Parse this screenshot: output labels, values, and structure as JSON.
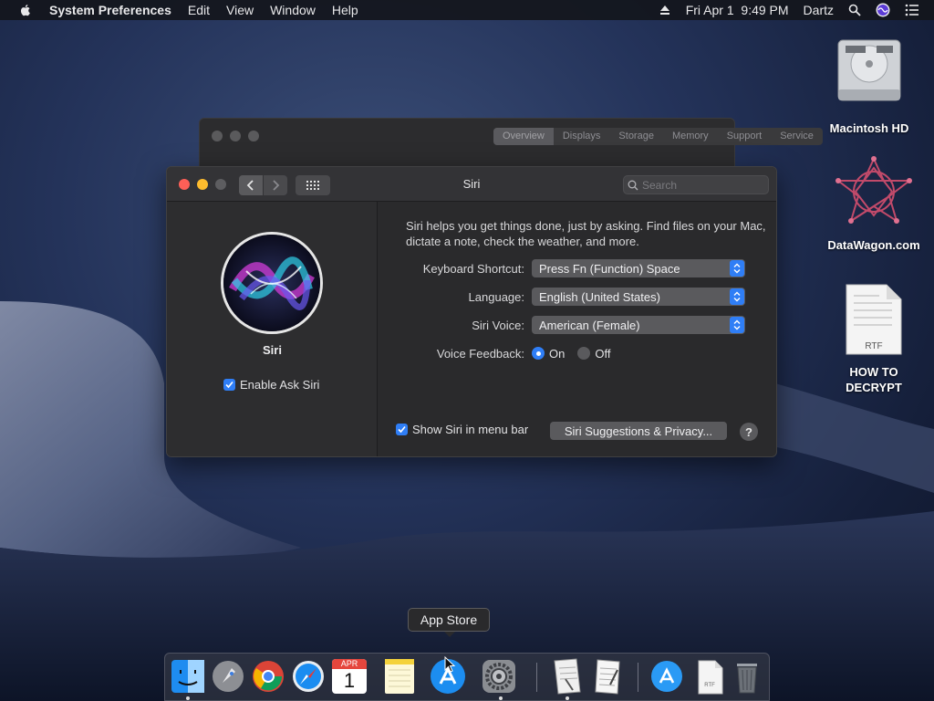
{
  "menubar": {
    "app_name": "System Preferences",
    "menus": [
      "Edit",
      "View",
      "Window",
      "Help"
    ],
    "datetime": "Fri Apr 1  9:49 PM",
    "user": "Dartz"
  },
  "background_window": {
    "tabs": [
      "Overview",
      "Displays",
      "Storage",
      "Memory",
      "Support",
      "Service"
    ]
  },
  "window": {
    "title": "Siri",
    "search_placeholder": "Search",
    "left": {
      "siri_label": "Siri",
      "enable_ask_siri": "Enable Ask Siri",
      "enable_checked": true
    },
    "description": "Siri helps you get things done, just by asking. Find files on your Mac, dictate a note, check the weather, and more.",
    "keyboard_shortcut": {
      "label": "Keyboard Shortcut:",
      "value": "Press Fn (Function) Space"
    },
    "language": {
      "label": "Language:",
      "value": "English (United States)"
    },
    "siri_voice": {
      "label": "Siri Voice:",
      "value": "American (Female)"
    },
    "voice_feedback": {
      "label": "Voice Feedback:",
      "on": "On",
      "off": "Off",
      "selected": "On"
    },
    "show_in_menu_bar": "Show Siri in menu bar",
    "show_checked": true,
    "suggestions_button": "Siri Suggestions & Privacy...",
    "help": "?"
  },
  "desktop": {
    "icons": [
      {
        "label": "Macintosh HD"
      },
      {
        "label": "DataWagon.com"
      },
      {
        "label": "HOW TO DECRYPT",
        "file_type": "RTF"
      }
    ]
  },
  "dock": {
    "tooltip": "App Store",
    "calendar": {
      "month": "APR",
      "day": "1"
    },
    "file_type": "RTF",
    "items": [
      "Finder",
      "Launchpad",
      "Chrome",
      "Safari",
      "Calendar",
      "Notes",
      "App Store",
      "System Preferences",
      "Document",
      "TextEdit",
      "App Store Downloads",
      "RTF Document",
      "Trash"
    ]
  },
  "colors": {
    "accent": "#2f7ef6",
    "close": "#fd5f57",
    "minimize": "#febc2e"
  }
}
